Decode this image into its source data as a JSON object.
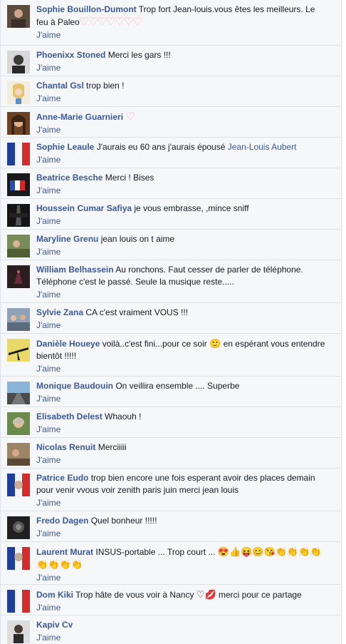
{
  "like_label": "J'aime",
  "colors": {
    "author": "#3b5998",
    "text": "#141823",
    "background": "#f6f7f9",
    "separator": "#e1e2e3"
  },
  "comments": [
    {
      "author": "Sophie Bouillon-Dumont",
      "text": "Trop fort Jean-louis.vous êtes les meilleurs. Le feu à Paleo",
      "emoji": "♡♡♡♡♡♡♡",
      "avatar": "portrait-avatar"
    },
    {
      "author": "Phoenixx Stoned",
      "text": "Merci les gars !!!",
      "avatar": "portrait-avatar"
    },
    {
      "author": "Chantal Gsl",
      "text": "trop bien !",
      "avatar": "illustration-avatar"
    },
    {
      "author": "Anne-Marie Guarnieri",
      "text": "",
      "emoji": "♡",
      "avatar": "portrait-avatar"
    },
    {
      "author": "Sophie Leaule",
      "text": "J'aurais eu 60 ans j'aurais épousé",
      "mention": "Jean-Louis Aubert",
      "avatar": "french-flag-avatar"
    },
    {
      "author": "Beatrice Besche",
      "text": "Merci ! Bises",
      "avatar": "flag-avatar"
    },
    {
      "author": "Houssein Cumar Safiya",
      "text": "je vous embrasse, ,mince sniff",
      "avatar": "paris-avatar"
    },
    {
      "author": "Maryline Grenu",
      "text": "jean louis on t aime",
      "avatar": "photo-avatar"
    },
    {
      "author": "William Belhassein",
      "text": "Au ronchons. Faut cesser de parler de téléphone. Téléphone c'est le passé. Seule la musique reste.....",
      "avatar": "dark-avatar"
    },
    {
      "author": "Sylvie Zana",
      "text": "CA c'est vraiment VOUS !!!",
      "avatar": "group-avatar"
    },
    {
      "author": "Danièle Houeye",
      "text": "voilà..c'est fini...pour ce soir",
      "text_after": "en espérant vous entendre bientôt !!!!!",
      "emoji": "🙂",
      "avatar": "silhouette-avatar"
    },
    {
      "author": "Monique Baudouin",
      "text": "On veillira ensemble .... Superbe",
      "avatar": "road-avatar"
    },
    {
      "author": "Elisabeth Delest",
      "text": "Whaouh !",
      "avatar": "portrait-avatar"
    },
    {
      "author": "Nicolas Renuit",
      "text": "Merciiiii",
      "avatar": "photo-avatar"
    },
    {
      "author": "Patrice Eudo",
      "text": "trop bien encore une fois esperant avoir des places demain pour venir vvous voir zenith paris juin merci jean louis",
      "avatar": "french-flag-avatar"
    },
    {
      "author": "Fredo Dagen",
      "text": "Quel bonheur !!!!!",
      "avatar": "dark-avatar"
    },
    {
      "author": "Laurent Murat",
      "text": "INSUS-portable ... Trop court ...",
      "emoji": "😍👍😝😊😘👏👏👏👏👏👏👏👏",
      "avatar": "french-flag-avatar"
    },
    {
      "author": "Dom Kiki",
      "text": "Trop hâte de vous voir à Nancy",
      "emoji": "♡💋",
      "text_after": "merci pour ce partage",
      "avatar": "french-flag-avatar"
    },
    {
      "author": "Kapiv Cv",
      "text": "",
      "avatar": "portrait-avatar"
    }
  ]
}
